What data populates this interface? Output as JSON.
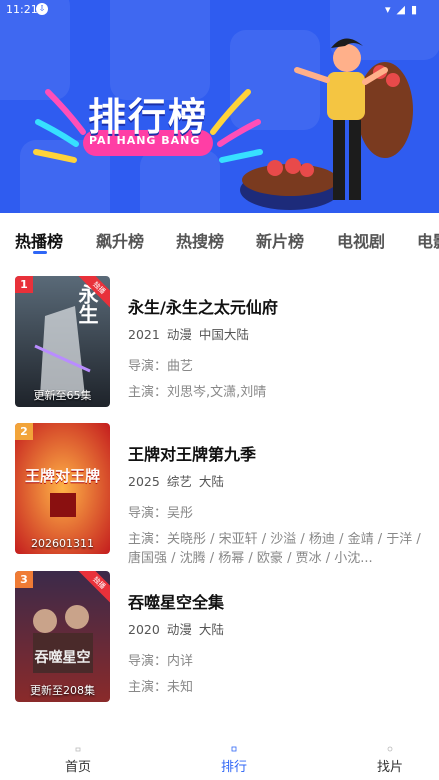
{
  "status_bar": {
    "time": "11:21"
  },
  "banner": {
    "title_cn": "排行榜",
    "title_en": "PAI HANG BANG"
  },
  "tabs": [
    "热播榜",
    "飙升榜",
    "热搜榜",
    "新片榜",
    "电视剧",
    "电影"
  ],
  "active_tab": 0,
  "items": [
    {
      "rank": "1",
      "badge": "独播",
      "poster_caption": "更新至65集",
      "poster_text": "永生",
      "name": "永生/永生之太元仙府",
      "year": "2021",
      "genre": "动漫",
      "region": "中国大陆",
      "director": "导演：曲艺",
      "actors": "主演：刘思岑,文潇,刘晴"
    },
    {
      "rank": "2",
      "badge": "",
      "poster_caption": "202601311",
      "poster_text": "王牌对王牌",
      "name": "王牌对王牌第九季",
      "year": "2025",
      "genre": "综艺",
      "region": "大陆",
      "director": "导演：吴彤",
      "actors": "主演：关晓彤 / 宋亚轩 / 沙溢 / 杨迪 / 金靖 / 于洋 / 唐国强 / 沈腾 / 杨幂 / 欧豪 / 贾冰 / 小沈..."
    },
    {
      "rank": "3",
      "badge": "独播",
      "poster_caption": "更新至208集",
      "poster_text": "吞噬星空",
      "name": "吞噬星空全集",
      "year": "2020",
      "genre": "动漫",
      "region": "大陆",
      "director": "导演：内详",
      "actors": "主演：未知"
    }
  ],
  "bottom_nav": [
    "首页",
    "排行",
    "找片"
  ],
  "active_nav": 1,
  "colors": {
    "accent": "#2f66f6",
    "banner_bg": "#2f5cf0",
    "rank_1": "#e8313a",
    "rank_2": "#f2a43a",
    "rank_3": "#ef7b35"
  }
}
